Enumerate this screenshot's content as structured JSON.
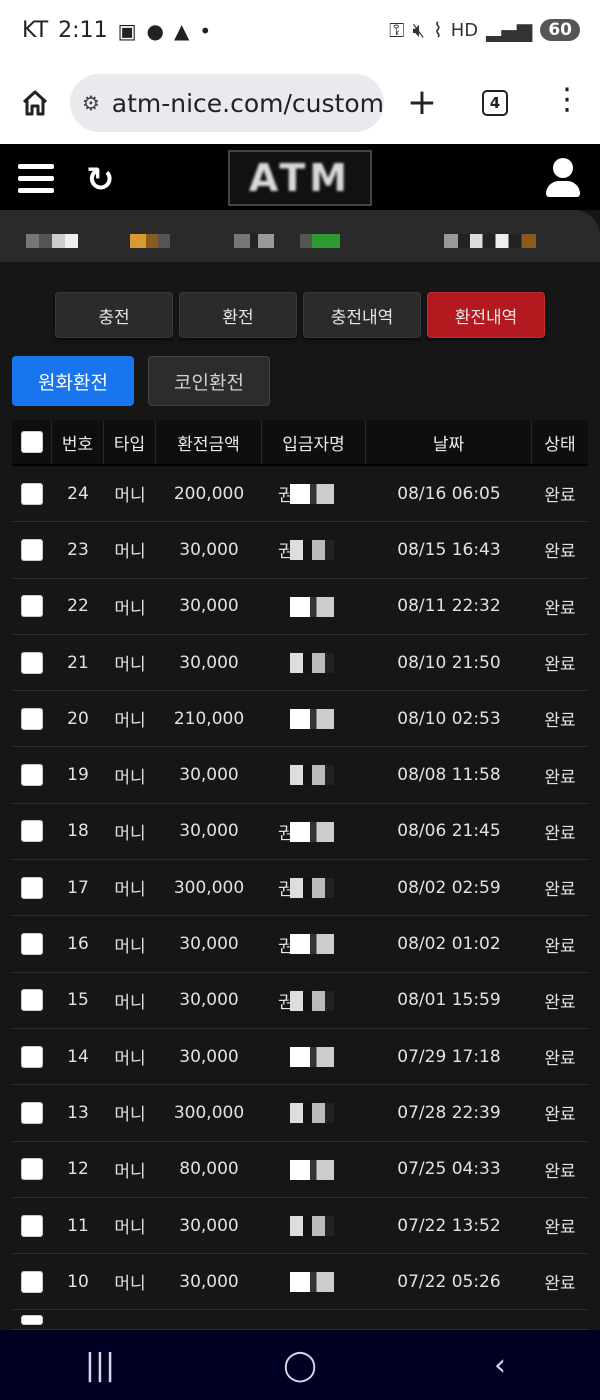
{
  "status_bar": {
    "carrier": "KT",
    "time": "2:11",
    "hd": "HD",
    "battery": "60",
    "icons": [
      "screenshot-icon",
      "kakaotalk-icon",
      "warning-icon",
      "key-icon",
      "mute-icon",
      "wifi-icon",
      "signal-icon"
    ]
  },
  "browser": {
    "url": "atm-nice.com/custom",
    "tab_count": "4"
  },
  "site": {
    "logo": "ATM"
  },
  "tabs": [
    {
      "label": "충전",
      "active": false
    },
    {
      "label": "환전",
      "active": false
    },
    {
      "label": "충전내역",
      "active": false
    },
    {
      "label": "환전내역",
      "active": true
    }
  ],
  "subtabs": [
    {
      "label": "원화환전",
      "active": true
    },
    {
      "label": "코인환전",
      "active": false
    }
  ],
  "table": {
    "headers": [
      "번호",
      "타입",
      "환전금액",
      "입금자명",
      "날짜",
      "상태"
    ],
    "rows": [
      {
        "no": "24",
        "type": "머니",
        "amount": "200,000",
        "name": "권",
        "date": "08/16 06:05",
        "status": "완료"
      },
      {
        "no": "23",
        "type": "머니",
        "amount": "30,000",
        "name": "권",
        "date": "08/15 16:43",
        "status": "완료"
      },
      {
        "no": "22",
        "type": "머니",
        "amount": "30,000",
        "name": "",
        "date": "08/11 22:32",
        "status": "완료"
      },
      {
        "no": "21",
        "type": "머니",
        "amount": "30,000",
        "name": "",
        "date": "08/10 21:50",
        "status": "완료"
      },
      {
        "no": "20",
        "type": "머니",
        "amount": "210,000",
        "name": "",
        "date": "08/10 02:53",
        "status": "완료"
      },
      {
        "no": "19",
        "type": "머니",
        "amount": "30,000",
        "name": "",
        "date": "08/08 11:58",
        "status": "완료"
      },
      {
        "no": "18",
        "type": "머니",
        "amount": "30,000",
        "name": "권",
        "date": "08/06 21:45",
        "status": "완료"
      },
      {
        "no": "17",
        "type": "머니",
        "amount": "300,000",
        "name": "권",
        "date": "08/02 02:59",
        "status": "완료"
      },
      {
        "no": "16",
        "type": "머니",
        "amount": "30,000",
        "name": "권",
        "date": "08/02 01:02",
        "status": "완료"
      },
      {
        "no": "15",
        "type": "머니",
        "amount": "30,000",
        "name": "권",
        "date": "08/01 15:59",
        "status": "완료"
      },
      {
        "no": "14",
        "type": "머니",
        "amount": "30,000",
        "name": "",
        "date": "07/29 17:18",
        "status": "완료"
      },
      {
        "no": "13",
        "type": "머니",
        "amount": "300,000",
        "name": "",
        "date": "07/28 22:39",
        "status": "완료"
      },
      {
        "no": "12",
        "type": "머니",
        "amount": "80,000",
        "name": "",
        "date": "07/25 04:33",
        "status": "완료"
      },
      {
        "no": "11",
        "type": "머니",
        "amount": "30,000",
        "name": "",
        "date": "07/22 13:52",
        "status": "완료"
      },
      {
        "no": "10",
        "type": "머니",
        "amount": "30,000",
        "name": "",
        "date": "07/22 05:26",
        "status": "완료"
      }
    ]
  },
  "colors": {
    "active_tab": "#b3191e",
    "active_subtab": "#1875ee",
    "background": "#161616"
  }
}
